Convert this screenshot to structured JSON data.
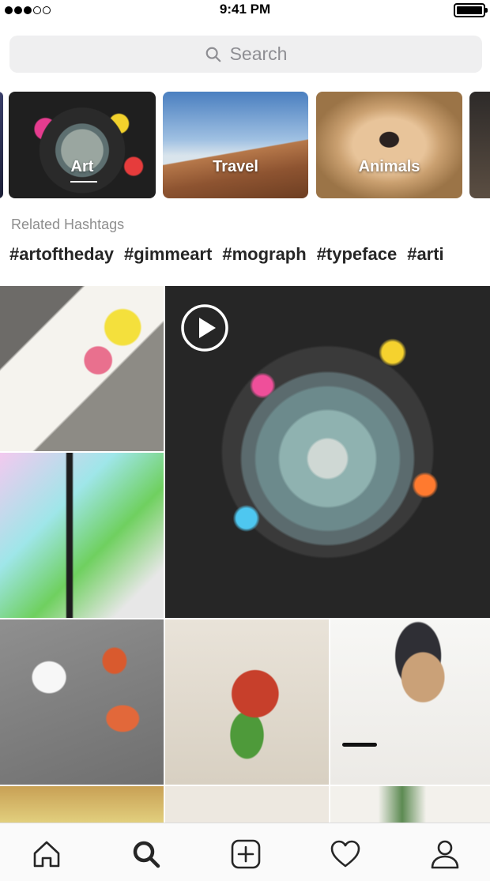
{
  "status_bar": {
    "time": "9:41 PM",
    "signal_bars_filled": 3,
    "signal_bars_total": 5,
    "battery_level": 1.0
  },
  "search": {
    "placeholder": "Search",
    "icon": "search-icon"
  },
  "topics": [
    {
      "label": "",
      "selected": false
    },
    {
      "label": "Art",
      "selected": true
    },
    {
      "label": "Travel",
      "selected": false
    },
    {
      "label": "Animals",
      "selected": false
    },
    {
      "label": "",
      "selected": false
    }
  ],
  "related": {
    "title": "Related Hashtags",
    "hashtags": [
      "#artoftheday",
      "#gimmeart",
      "#mograph",
      "#typeface",
      "#arti"
    ]
  },
  "grid": {
    "video_icon": "play-icon"
  },
  "tab_bar": {
    "items": [
      {
        "name": "home",
        "icon": "home-icon"
      },
      {
        "name": "search",
        "icon": "search-icon",
        "active": true
      },
      {
        "name": "new-post",
        "icon": "add-square-icon"
      },
      {
        "name": "activity",
        "icon": "heart-icon"
      },
      {
        "name": "profile",
        "icon": "person-icon"
      }
    ]
  },
  "colors": {
    "text": "#262626",
    "secondary_text": "#8e8e8e",
    "search_bg": "#efeff0"
  }
}
